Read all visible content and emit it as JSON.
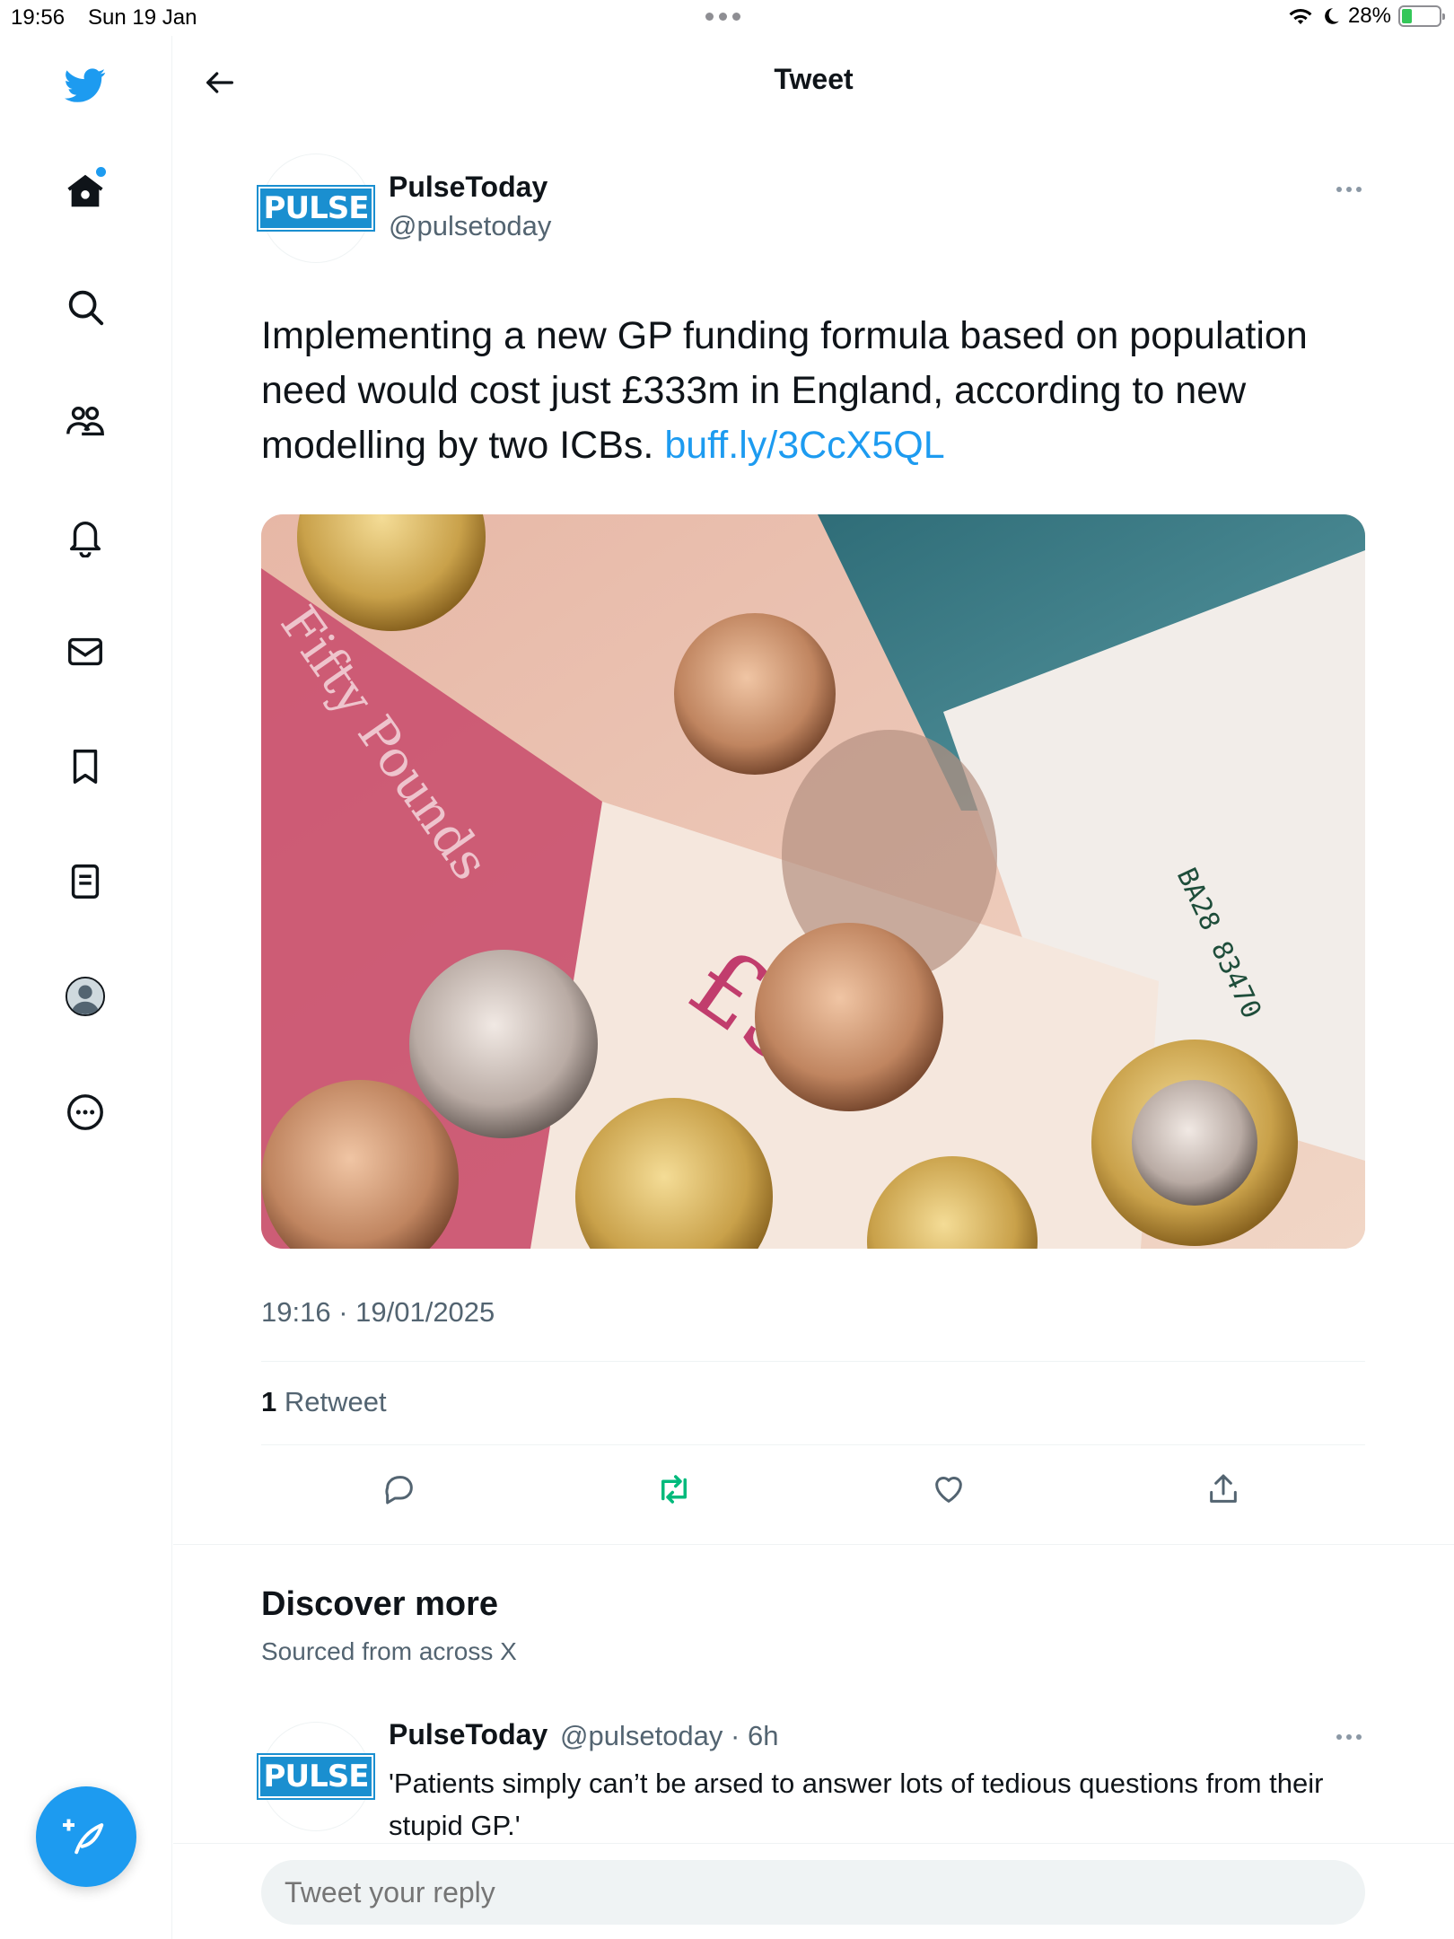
{
  "status_bar": {
    "time": "19:56",
    "date": "Sun 19 Jan",
    "battery": "28%"
  },
  "header": {
    "title": "Tweet"
  },
  "tweet": {
    "author_name": "PulseToday",
    "author_handle": "@pulsetoday",
    "avatar_logo": "PULSE",
    "text": "Implementing a new GP funding formula based on population need would cost just £333m in England, according to new modelling by two ICBs.",
    "link": "buff.ly/3CcX5QL",
    "timestamp": "19:16 · 19/01/2025",
    "retweet_count": "1",
    "retweet_label": "Retweet"
  },
  "discover": {
    "title": "Discover more",
    "subtitle": "Sourced from across X"
  },
  "recommended": {
    "author_name": "PulseToday",
    "meta": "@pulsetoday · 6h",
    "avatar_logo": "PULSE",
    "text": "'Patients simply can’t be arsed to answer lots of tedious questions from their stupid GP.'"
  },
  "reply": {
    "placeholder": "Tweet your reply"
  },
  "colors": {
    "accent": "#1d9bf0",
    "retweet_active": "#00ba7c",
    "text_secondary": "#536471"
  },
  "icons": [
    "twitter-bird-icon",
    "home-icon",
    "search-icon",
    "communities-icon",
    "notifications-icon",
    "messages-icon",
    "bookmarks-icon",
    "lists-icon",
    "profile-icon",
    "more-icon",
    "compose-icon"
  ]
}
